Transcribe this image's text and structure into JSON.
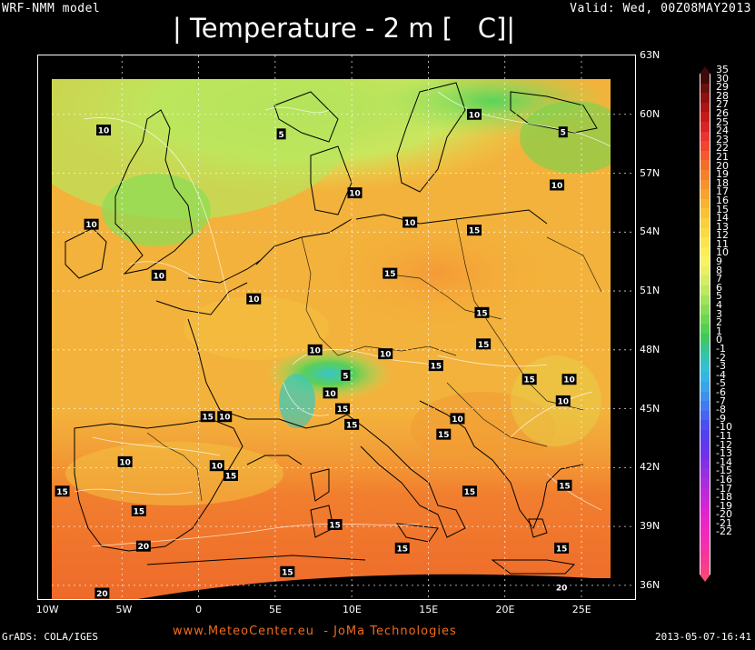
{
  "header": {
    "model": "WRF-NMM model",
    "valid": "Valid: Wed, 00Z08MAY2013",
    "title": "| Temperature - 2 m [   C]|"
  },
  "map": {
    "lat_labels": [
      "63N",
      "60N",
      "57N",
      "54N",
      "51N",
      "48N",
      "45N",
      "42N",
      "39N",
      "36N"
    ],
    "lon_labels": [
      "10W",
      "5W",
      "0",
      "5E",
      "10E",
      "15E",
      "20E",
      "25E"
    ],
    "contour_labels": [
      {
        "text": "10",
        "lon": -6.2,
        "lat": 59.2
      },
      {
        "text": "10",
        "lon": -7.0,
        "lat": 54.4
      },
      {
        "text": "10",
        "lon": -2.6,
        "lat": 51.8
      },
      {
        "text": "5",
        "lon": 5.4,
        "lat": 59.0
      },
      {
        "text": "10",
        "lon": 18.0,
        "lat": 60.0
      },
      {
        "text": "5",
        "lon": 23.8,
        "lat": 59.1
      },
      {
        "text": "10",
        "lon": 10.2,
        "lat": 56.0
      },
      {
        "text": "10",
        "lon": 13.8,
        "lat": 54.5
      },
      {
        "text": "15",
        "lon": 18.0,
        "lat": 54.1
      },
      {
        "text": "10",
        "lon": 23.4,
        "lat": 56.4
      },
      {
        "text": "10",
        "lon": 3.6,
        "lat": 50.6
      },
      {
        "text": "15",
        "lon": 12.5,
        "lat": 51.9
      },
      {
        "text": "15",
        "lon": 18.5,
        "lat": 49.9
      },
      {
        "text": "15",
        "lon": 18.6,
        "lat": 48.3
      },
      {
        "text": "10",
        "lon": 7.6,
        "lat": 48.0
      },
      {
        "text": "10",
        "lon": 12.2,
        "lat": 47.8
      },
      {
        "text": "15",
        "lon": 15.5,
        "lat": 47.2
      },
      {
        "text": "5",
        "lon": 9.6,
        "lat": 46.7
      },
      {
        "text": "10",
        "lon": 8.6,
        "lat": 45.8
      },
      {
        "text": "15",
        "lon": 9.4,
        "lat": 45.0
      },
      {
        "text": "15",
        "lon": 10.0,
        "lat": 44.2
      },
      {
        "text": "15",
        "lon": 21.6,
        "lat": 46.5
      },
      {
        "text": "10",
        "lon": 24.2,
        "lat": 46.5
      },
      {
        "text": "10",
        "lon": 23.8,
        "lat": 45.4
      },
      {
        "text": "15",
        "lon": 0.6,
        "lat": 44.6
      },
      {
        "text": "10",
        "lon": 1.7,
        "lat": 44.6
      },
      {
        "text": "10",
        "lon": 16.9,
        "lat": 44.5
      },
      {
        "text": "15",
        "lon": 16.0,
        "lat": 43.7
      },
      {
        "text": "10",
        "lon": -4.8,
        "lat": 42.3
      },
      {
        "text": "10",
        "lon": 1.2,
        "lat": 42.1
      },
      {
        "text": "15",
        "lon": 2.1,
        "lat": 41.6
      },
      {
        "text": "15",
        "lon": -8.9,
        "lat": 40.8
      },
      {
        "text": "15",
        "lon": -3.9,
        "lat": 39.8
      },
      {
        "text": "20",
        "lon": -3.6,
        "lat": 38.0
      },
      {
        "text": "15",
        "lon": 8.9,
        "lat": 39.1
      },
      {
        "text": "15",
        "lon": 17.7,
        "lat": 40.8
      },
      {
        "text": "15",
        "lon": 13.3,
        "lat": 37.9
      },
      {
        "text": "15",
        "lon": 23.9,
        "lat": 41.1
      },
      {
        "text": "15",
        "lon": 23.7,
        "lat": 37.9
      },
      {
        "text": "15",
        "lon": 5.8,
        "lat": 36.7
      },
      {
        "text": "20",
        "lon": -6.3,
        "lat": 35.6
      },
      {
        "text": "20",
        "lon": 23.7,
        "lat": 35.9
      }
    ]
  },
  "colorbar": {
    "labels": [
      "35",
      "30",
      "29",
      "28",
      "27",
      "26",
      "25",
      "24",
      "23",
      "22",
      "21",
      "20",
      "19",
      "18",
      "17",
      "16",
      "15",
      "14",
      "13",
      "12",
      "11",
      "10",
      "9",
      "8",
      "7",
      "6",
      "5",
      "4",
      "3",
      "2",
      "1",
      "0",
      "-1",
      "-2",
      "-3",
      "-4",
      "-5",
      "-6",
      "-7",
      "-8",
      "-9",
      "-10",
      "-11",
      "-12",
      "-13",
      "-14",
      "-15",
      "-16",
      "-17",
      "-18",
      "-19",
      "-20",
      "-21",
      "-22"
    ],
    "colors": [
      "#3f0a0a",
      "#6b0e0e",
      "#8e1010",
      "#aa1414",
      "#c41a1a",
      "#d92424",
      "#ea3430",
      "#f2452f",
      "#f45a2d",
      "#f56d2c",
      "#f6802c",
      "#f7922e",
      "#f8a22f",
      "#f9b232",
      "#fac137",
      "#fbce3c",
      "#fcda43",
      "#fde44c",
      "#fded57",
      "#f8f360",
      "#e9f064",
      "#d5ec63",
      "#bde85f",
      "#a3e25a",
      "#88dc55",
      "#6dd650",
      "#54cf52",
      "#40c85e",
      "#38c38f",
      "#35c1b4",
      "#34bfd2",
      "#33b6e3",
      "#3aa3ea",
      "#3f8fed",
      "#4379ef",
      "#4763f0",
      "#4b4ef1",
      "#5340f0",
      "#6038ec",
      "#7031e8",
      "#8230e4",
      "#962fe0",
      "#a92ddc",
      "#bb2ad8",
      "#cc27d4",
      "#dc24cf",
      "#ea25c8",
      "#f028be",
      "#f32db2",
      "#f532a4",
      "#f63995",
      "#f74185"
    ],
    "top_arrow_color": "#3f0a0a",
    "bottom_arrow_color": "#f74a79"
  },
  "footer": {
    "grads": "GrADS: COLA/IGES",
    "credit": "www.MeteoCenter.eu  - JoMa Technologies",
    "timestamp": "2013-05-07-16:41"
  },
  "palette": {
    "sea_warm": "#f08a2e",
    "land_mid": "#f2b233",
    "cool_green": "#8fdc55",
    "cold_cyan": "#38c7a2",
    "frame": "#ffffff"
  }
}
